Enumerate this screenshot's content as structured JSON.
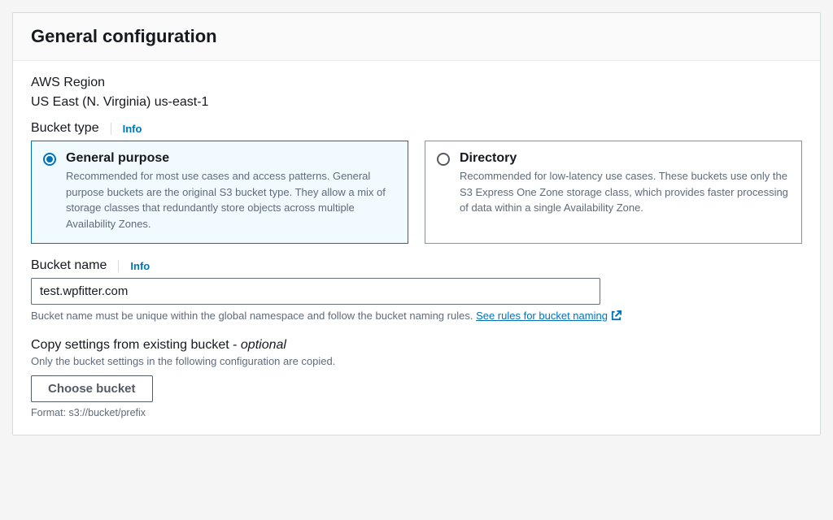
{
  "panel": {
    "title": "General configuration"
  },
  "region": {
    "label": "AWS Region",
    "value": "US East (N. Virginia) us-east-1"
  },
  "bucketType": {
    "label": "Bucket type",
    "info": "Info",
    "options": {
      "general": {
        "title": "General purpose",
        "desc": "Recommended for most use cases and access patterns. General purpose buckets are the original S3 bucket type. They allow a mix of storage classes that redundantly store objects across multiple Availability Zones."
      },
      "directory": {
        "title": "Directory",
        "desc": "Recommended for low-latency use cases. These buckets use only the S3 Express One Zone storage class, which provides faster processing of data within a single Availability Zone."
      }
    }
  },
  "bucketName": {
    "label": "Bucket name",
    "info": "Info",
    "value": "test.wpfitter.com",
    "hintPrefix": "Bucket name must be unique within the global namespace and follow the bucket naming rules. ",
    "hintLink": "See rules for bucket naming"
  },
  "copySettings": {
    "labelPrefix": "Copy settings from existing bucket - ",
    "labelSuffix": "optional",
    "desc": "Only the bucket settings in the following configuration are copied.",
    "button": "Choose bucket",
    "format": "Format: s3://bucket/prefix"
  }
}
